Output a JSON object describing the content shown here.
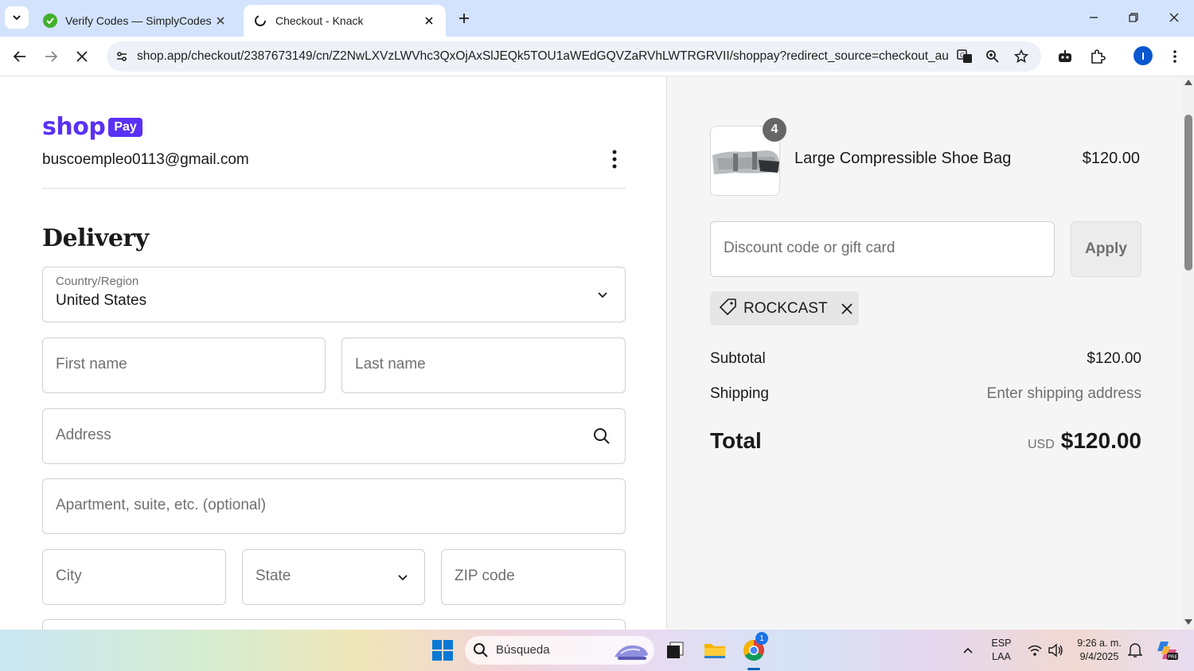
{
  "browser": {
    "tabs": [
      {
        "title": "Verify Codes — SimplyCodes",
        "active": false
      },
      {
        "title": "Checkout - Knack",
        "active": true
      }
    ],
    "url": "shop.app/checkout/2387673149/cn/Z2NwLXVzLWVhc3QxOjAxSlJEQk5TOU1aWEdGQVZaRVhLWTRGRVII/shoppay?redirect_source=checkout_autom...",
    "profile_initial": "I",
    "accent": "#d3e3fd"
  },
  "checkout": {
    "brand": {
      "shop": "shop",
      "pay": "Pay",
      "color": "#5a31f4"
    },
    "email": "buscoempleo0113@gmail.com",
    "delivery_heading": "Delivery",
    "country_label": "Country/Region",
    "country_value": "United States",
    "placeholders": {
      "first_name": "First name",
      "last_name": "Last name",
      "address": "Address",
      "apartment": "Apartment, suite, etc. (optional)",
      "city": "City",
      "state": "State",
      "zip": "ZIP code"
    }
  },
  "summary": {
    "item": {
      "name": "Large Compressible Shoe Bag",
      "price": "$120.00",
      "quantity": "4"
    },
    "discount_placeholder": "Discount code or gift card",
    "apply_label": "Apply",
    "applied_code": "ROCKCAST",
    "subtotal_label": "Subtotal",
    "subtotal_value": "$120.00",
    "shipping_label": "Shipping",
    "shipping_value": "Enter shipping address",
    "total_label": "Total",
    "currency": "USD",
    "total_value": "$120.00"
  },
  "taskbar": {
    "search_text": "Búsqueda",
    "language": "ESP",
    "layout": "LAA",
    "time": "9:26 a. m.",
    "date": "9/4/2025",
    "chrome_badge": "1"
  }
}
